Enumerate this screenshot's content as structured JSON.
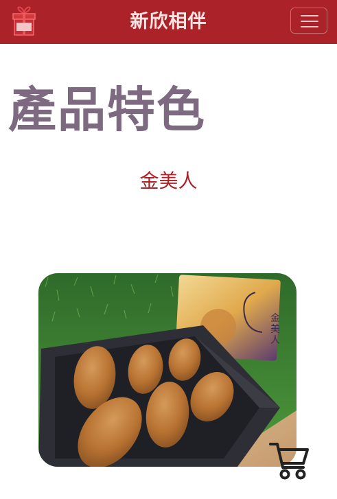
{
  "navbar": {
    "brand": "新欣相伴",
    "logo_icon": "gift-box-logo-icon",
    "toggler_icon": "hamburger-menu-icon"
  },
  "section": {
    "title": "產品特色"
  },
  "product": {
    "name": "金美人",
    "box_label": "金美人",
    "image_subject": "golden sweet-potato shaped pastries in a gift box on grass"
  },
  "floating": {
    "cart_icon": "shopping-cart-icon"
  },
  "colors": {
    "brand_red": "#ab2328",
    "title_purple": "#7d6a80",
    "brand_text": "#fbe3e3"
  }
}
